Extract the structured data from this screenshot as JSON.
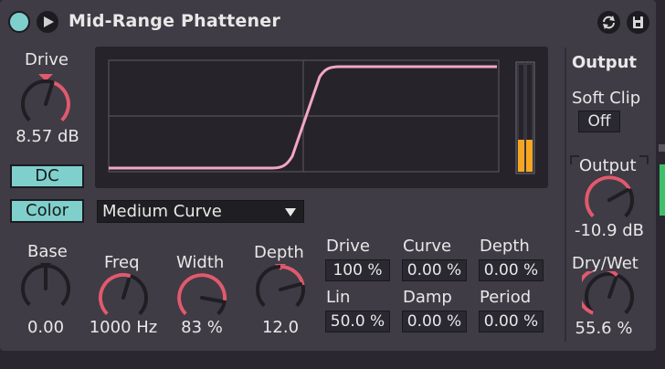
{
  "header": {
    "title": "Mid-Range Phattener"
  },
  "drive": {
    "label": "Drive",
    "value": "8.57 dB"
  },
  "buttons": {
    "dc": "DC",
    "color": "Color"
  },
  "curve_select": {
    "value": "Medium Curve"
  },
  "knobs": {
    "base": {
      "label": "Base",
      "value": "0.00"
    },
    "freq": {
      "label": "Freq",
      "value": "1000 Hz"
    },
    "width": {
      "label": "Width",
      "value": "83 %"
    },
    "depth": {
      "label": "Depth",
      "value": "12.0"
    }
  },
  "params": {
    "drive": {
      "label": "Drive",
      "value": "100 %"
    },
    "curve": {
      "label": "Curve",
      "value": "0.00 %"
    },
    "depth": {
      "label": "Depth",
      "value": "0.00 %"
    },
    "lin": {
      "label": "Lin",
      "value": "50.0 %"
    },
    "damp": {
      "label": "Damp",
      "value": "0.00 %"
    },
    "period": {
      "label": "Period",
      "value": "0.00 %"
    }
  },
  "output_section": {
    "heading": "Output",
    "soft_clip_label": "Soft Clip",
    "soft_clip_value": "Off",
    "output_label": "Output",
    "output_value": "-10.9 dB",
    "drywet_label": "Dry/Wet",
    "drywet_value": "55.6 %"
  },
  "colors": {
    "accent": "#7fd0cc",
    "knob_arc": "#e05a6e",
    "curve": "#f2a6c8",
    "meter": "#f5a623"
  },
  "icons": {
    "power": "power-icon",
    "play": "play-icon",
    "cycle": "cycle-icon",
    "save": "save-icon"
  }
}
